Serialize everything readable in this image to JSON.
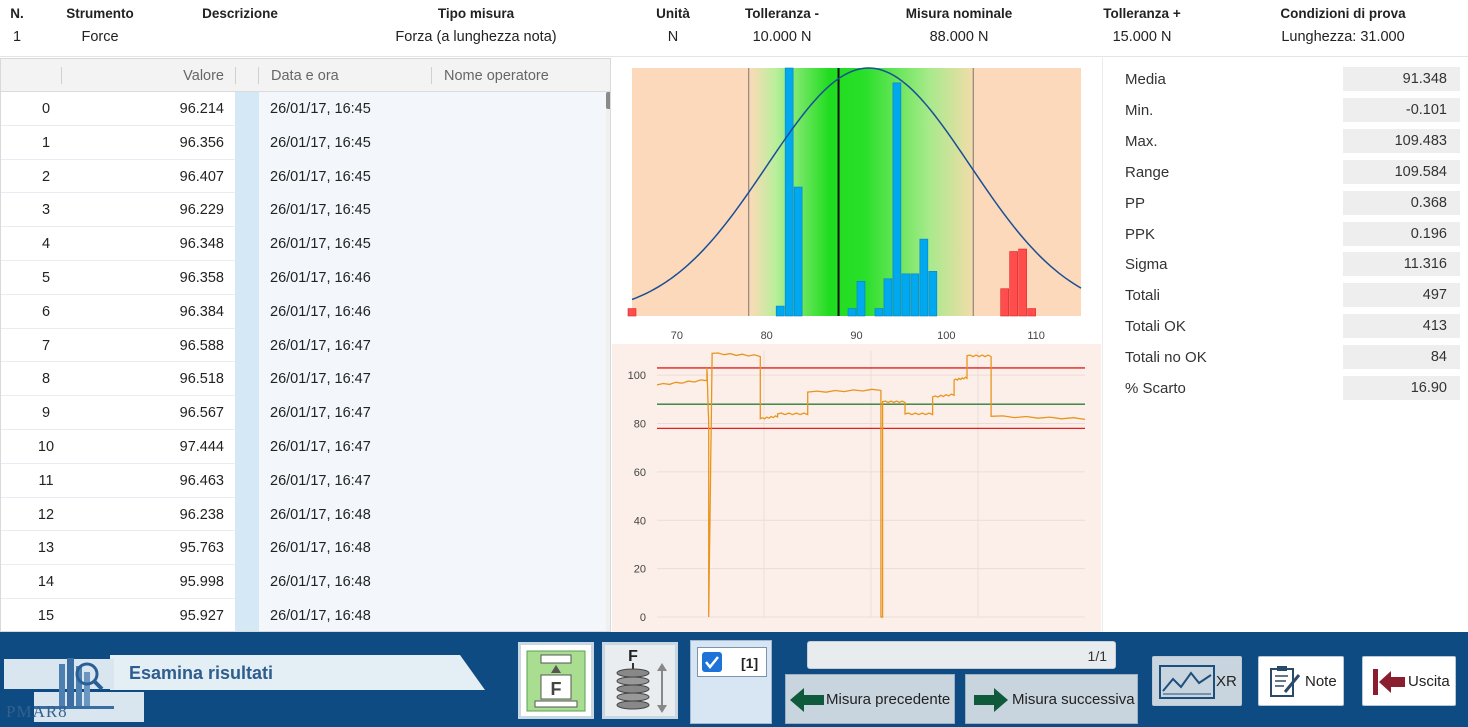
{
  "header": {
    "columns": [
      {
        "label": "N.",
        "value": "1"
      },
      {
        "label": "Strumento",
        "value": "Force"
      },
      {
        "label": "Descrizione",
        "value": ""
      },
      {
        "label": "Tipo misura",
        "value": "Forza (a lunghezza nota)"
      },
      {
        "label": "Unità",
        "value": "N"
      },
      {
        "label": "Tolleranza -",
        "value": "10.000 N"
      },
      {
        "label": "Misura nominale",
        "value": "88.000 N"
      },
      {
        "label": "Tolleranza +",
        "value": "15.000 N"
      },
      {
        "label": "Condizioni di prova",
        "value": "Lunghezza: 31.000"
      }
    ]
  },
  "table": {
    "headers": {
      "valore": "Valore",
      "data": "Data e ora",
      "operatore": "Nome operatore"
    },
    "rows": [
      {
        "index": "0",
        "value": "96.214",
        "datetime": "26/01/17, 16:45"
      },
      {
        "index": "1",
        "value": "96.356",
        "datetime": "26/01/17, 16:45"
      },
      {
        "index": "2",
        "value": "96.407",
        "datetime": "26/01/17, 16:45"
      },
      {
        "index": "3",
        "value": "96.229",
        "datetime": "26/01/17, 16:45"
      },
      {
        "index": "4",
        "value": "96.348",
        "datetime": "26/01/17, 16:45"
      },
      {
        "index": "5",
        "value": "96.358",
        "datetime": "26/01/17, 16:46"
      },
      {
        "index": "6",
        "value": "96.384",
        "datetime": "26/01/17, 16:46"
      },
      {
        "index": "7",
        "value": "96.588",
        "datetime": "26/01/17, 16:47"
      },
      {
        "index": "8",
        "value": "96.518",
        "datetime": "26/01/17, 16:47"
      },
      {
        "index": "9",
        "value": "96.567",
        "datetime": "26/01/17, 16:47"
      },
      {
        "index": "10",
        "value": "97.444",
        "datetime": "26/01/17, 16:47"
      },
      {
        "index": "11",
        "value": "96.463",
        "datetime": "26/01/17, 16:47"
      },
      {
        "index": "12",
        "value": "96.238",
        "datetime": "26/01/17, 16:48"
      },
      {
        "index": "13",
        "value": "95.763",
        "datetime": "26/01/17, 16:48"
      },
      {
        "index": "14",
        "value": "95.998",
        "datetime": "26/01/17, 16:48"
      },
      {
        "index": "15",
        "value": "95.927",
        "datetime": "26/01/17, 16:48"
      }
    ]
  },
  "stats": [
    {
      "label": "Media",
      "value": "91.348"
    },
    {
      "label": "Min.",
      "value": "-0.101"
    },
    {
      "label": "Max.",
      "value": "109.483"
    },
    {
      "label": "Range",
      "value": "109.584"
    },
    {
      "label": "PP",
      "value": "0.368"
    },
    {
      "label": "PPK",
      "value": "0.196"
    },
    {
      "label": "Sigma",
      "value": "11.316"
    },
    {
      "label": "Totali",
      "value": "497"
    },
    {
      "label": "Totali OK",
      "value": "413"
    },
    {
      "label": "Totali no OK",
      "value": "84"
    },
    {
      "label": "% Scarto",
      "value": "16.90"
    }
  ],
  "chart_data": [
    {
      "type": "bar",
      "xlim": [
        65,
        115
      ],
      "x_ticks": [
        70,
        80,
        90,
        100,
        110
      ],
      "tolerance_limits": [
        78,
        103
      ],
      "nominal": 88,
      "mean": 91.348,
      "sigma": 11.316,
      "in_tolerance_color": "#00a8f0",
      "out_tolerance_color": "#ff4d4d",
      "bins": [
        {
          "x": 65,
          "freq": 0.03,
          "ok": false
        },
        {
          "x": 81.5,
          "freq": 0.04,
          "ok": true
        },
        {
          "x": 82.5,
          "freq": 1.0,
          "ok": true
        },
        {
          "x": 83.5,
          "freq": 0.52,
          "ok": true
        },
        {
          "x": 89.5,
          "freq": 0.03,
          "ok": true
        },
        {
          "x": 90.5,
          "freq": 0.14,
          "ok": true
        },
        {
          "x": 92.5,
          "freq": 0.03,
          "ok": true
        },
        {
          "x": 93.5,
          "freq": 0.15,
          "ok": true
        },
        {
          "x": 94.5,
          "freq": 0.94,
          "ok": true
        },
        {
          "x": 95.5,
          "freq": 0.17,
          "ok": true
        },
        {
          "x": 96.5,
          "freq": 0.17,
          "ok": true
        },
        {
          "x": 97.5,
          "freq": 0.31,
          "ok": true
        },
        {
          "x": 98.5,
          "freq": 0.18,
          "ok": true
        },
        {
          "x": 106.5,
          "freq": 0.11,
          "ok": false
        },
        {
          "x": 107.5,
          "freq": 0.26,
          "ok": false
        },
        {
          "x": 108.5,
          "freq": 0.27,
          "ok": false
        },
        {
          "x": 109.5,
          "freq": 0.03,
          "ok": false
        }
      ]
    },
    {
      "type": "line",
      "ylim": [
        0,
        110
      ],
      "y_ticks": [
        0,
        20,
        40,
        60,
        80,
        100
      ],
      "xlim": [
        0,
        497
      ],
      "upper_limit": 103,
      "lower_limit": 78,
      "nominal": 88,
      "line_color": "#e8951e",
      "limit_color": "#e02020",
      "nominal_color": "#2e7d32",
      "segments": [
        {
          "x": [
            0,
            58
          ],
          "y": [
            96,
            98
          ]
        },
        {
          "x": [
            58,
            60
          ],
          "y": [
            103,
            80
          ]
        },
        {
          "x": [
            60,
            64
          ],
          "y": [
            0,
            108
          ]
        },
        {
          "x": [
            64,
            120
          ],
          "y": [
            109,
            108
          ]
        },
        {
          "x": [
            120,
            140
          ],
          "y": [
            82,
            83
          ]
        },
        {
          "x": [
            140,
            175
          ],
          "y": [
            84,
            84
          ]
        },
        {
          "x": [
            175,
            260
          ],
          "y": [
            93,
            94
          ]
        },
        {
          "x": [
            260,
            262
          ],
          "y": [
            0,
            0
          ]
        },
        {
          "x": [
            262,
            288
          ],
          "y": [
            89,
            89
          ]
        },
        {
          "x": [
            288,
            320
          ],
          "y": [
            84,
            84
          ]
        },
        {
          "x": [
            320,
            345
          ],
          "y": [
            91,
            92
          ]
        },
        {
          "x": [
            345,
            360
          ],
          "y": [
            98,
            99
          ]
        },
        {
          "x": [
            360,
            388
          ],
          "y": [
            108,
            108
          ]
        },
        {
          "x": [
            388,
            497
          ],
          "y": [
            83,
            82
          ]
        }
      ]
    }
  ],
  "footer": {
    "title": "Esamina risultati",
    "logo_text": "PMAR8",
    "checkbox_label": "[1]",
    "progress_text": "1/1",
    "prev_label": "Misura precedente",
    "next_label": "Misura successiva",
    "xr_label": "XR",
    "note_label": "Note",
    "exit_label": "Uscita"
  }
}
